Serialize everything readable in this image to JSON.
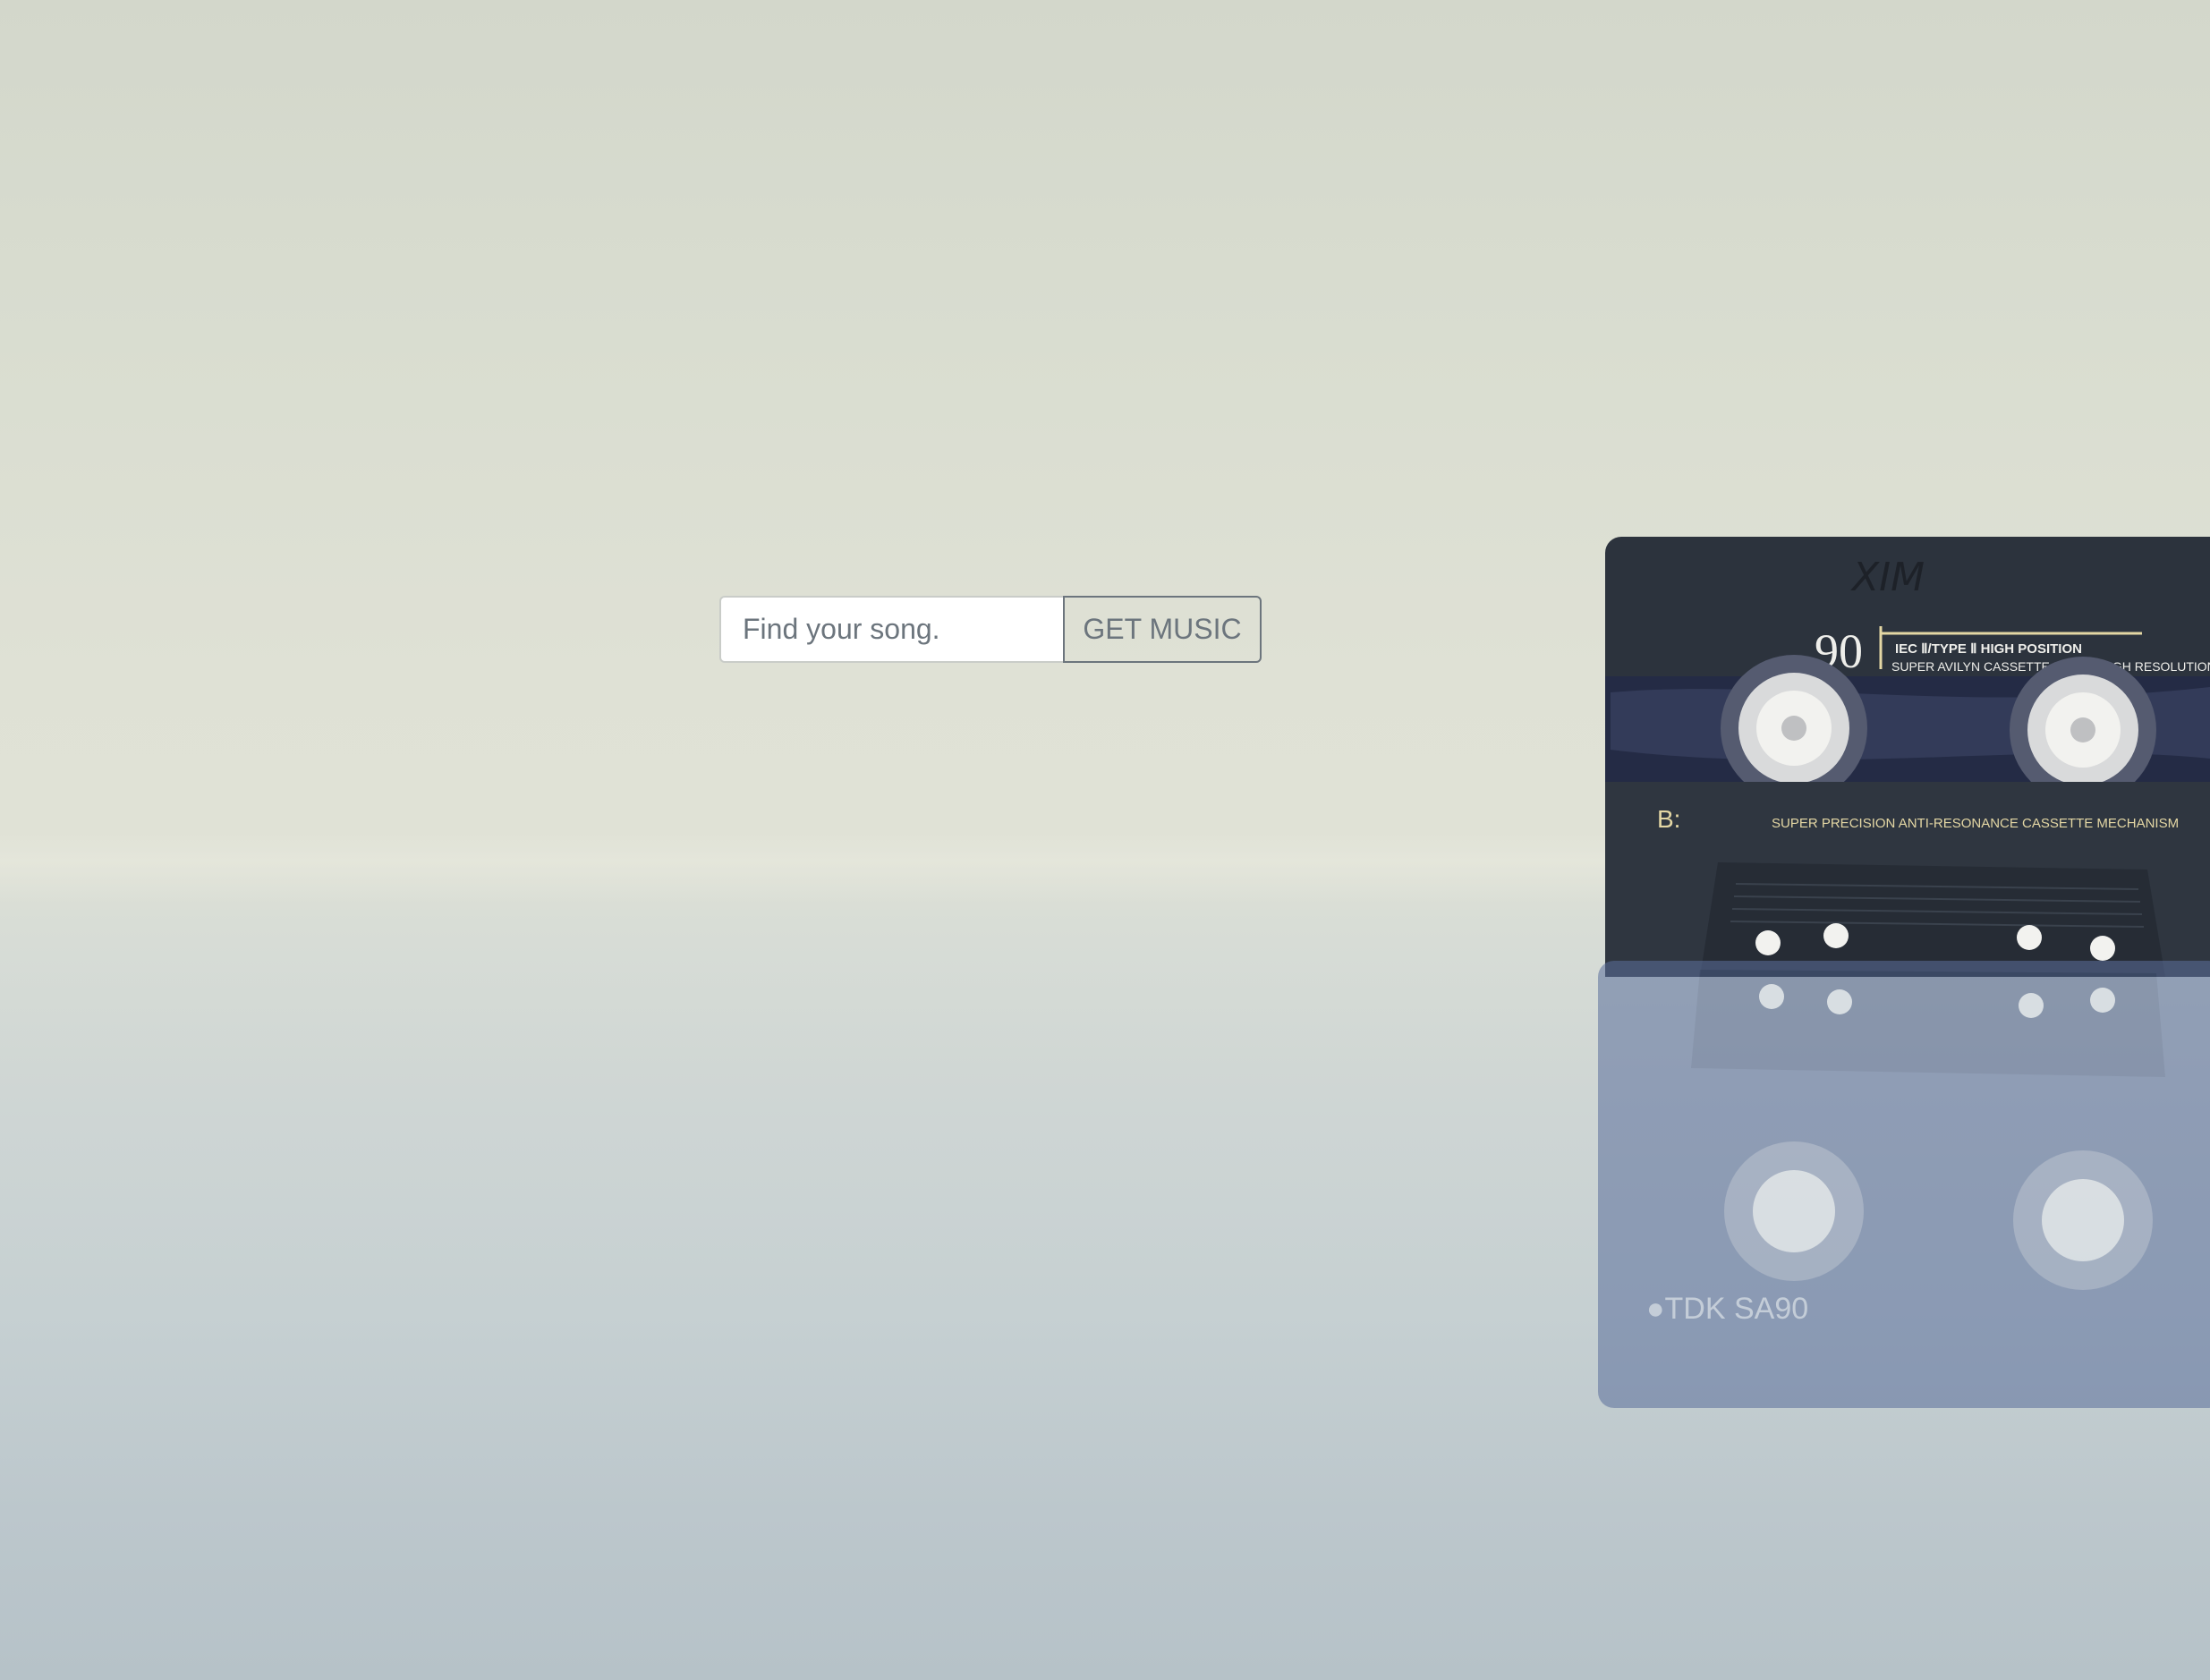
{
  "search": {
    "placeholder": "Find your song.",
    "value": "",
    "button_label": "GET MUSIC"
  },
  "cassette": {
    "handwriting": "XIM",
    "length": "90",
    "type_line": "IEC Ⅱ/TYPE Ⅱ HIGH POSITION",
    "tape_line": "SUPER AVILYN CASSETTE SUPER HIGH RESOLUTION",
    "side": "B:",
    "mechanism_line": "SUPER PRECISION ANTI-RESONANCE CASSETTE MECHANISM",
    "reflection_brand": "●TDK SA90"
  },
  "colors": {
    "button_outline": "#6c757d",
    "cassette_body": "#2c333d",
    "label_gold": "#e4d7a4"
  }
}
